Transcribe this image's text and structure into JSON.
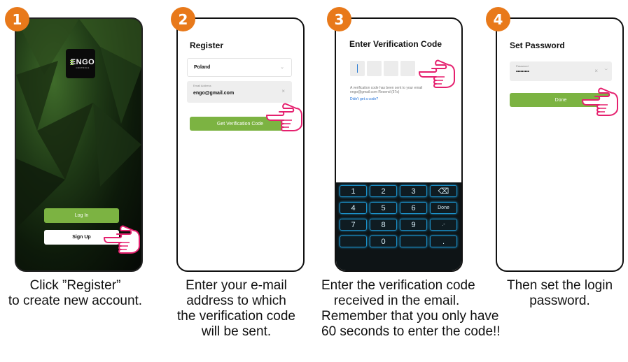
{
  "steps": [
    {
      "number": "1",
      "logo": {
        "text": "ENGO",
        "subtext": "CONTROLS"
      },
      "buttons": {
        "login": "Log In",
        "signup": "Sign Up"
      },
      "caption": [
        "Click ”Register”",
        "to create new account."
      ]
    },
    {
      "number": "2",
      "title": "Register",
      "country": "Poland",
      "email_label": "Email Address",
      "email_value": "engo@gmail.com",
      "button": "Get Verification Code",
      "caption": [
        "Enter your e-mail",
        "address to which",
        "the verification code",
        "will be sent."
      ]
    },
    {
      "number": "3",
      "title": "Enter Verification Code",
      "info_line1": "A verification code has been sent to your email",
      "info_line2": "engo@gmail.com Resend (57s)",
      "link": "Didn't get a code?",
      "keys": [
        "1",
        "2",
        "3",
        "⌫",
        "4",
        "5",
        "6",
        "Done",
        "7",
        "8",
        "9",
        ".-",
        "",
        "0",
        ""
      ],
      "caption": [
        "Enter the verification code",
        "received in the email.",
        "Remember that you only have",
        "60 seconds to enter the code!!"
      ]
    },
    {
      "number": "4",
      "title": "Set Password",
      "password_label": "Password",
      "password_value": "•••••••••",
      "button": "Done",
      "caption": [
        "Then set the login",
        "password."
      ]
    }
  ],
  "colors": {
    "badge": "#e8791a",
    "green": "#7cb342",
    "hand": "#e5206e",
    "link": "#1e6fd9"
  }
}
